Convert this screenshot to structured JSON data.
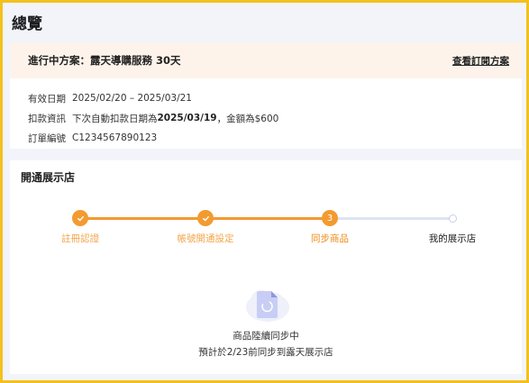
{
  "page": {
    "title": "總覽"
  },
  "plan": {
    "current_plan_label": "進行中方案：露天導購服務 30天",
    "view_link": "查看訂閱方案",
    "rows": [
      {
        "label": "有效日期",
        "value_prefix": "2025/02/20 – 2025/03/21",
        "value_bold": "",
        "value_suffix": ""
      },
      {
        "label": "扣款資訊",
        "value_prefix": "下次自動扣款日期為 ",
        "value_bold": "2025/03/19",
        "value_suffix": "，金額為$600"
      },
      {
        "label": "訂單編號",
        "value_prefix": "C1234567890123",
        "value_bold": "",
        "value_suffix": ""
      }
    ]
  },
  "store": {
    "title": "開通展示店",
    "steps": [
      {
        "label": "註冊認證",
        "status": "done",
        "icon": "check-icon"
      },
      {
        "label": "帳號開通設定",
        "status": "done",
        "icon": "check-icon"
      },
      {
        "label": "同步商品",
        "status": "current",
        "number": "3"
      },
      {
        "label": "我的展示店",
        "status": "pending"
      }
    ],
    "sync_message": "商品陸續同步中",
    "sync_eta": "預計於2/23前同步到露天展示店"
  },
  "colors": {
    "accent": "#f39a30",
    "frame": "#f2c01f",
    "plan_header_bg": "#fdf3ea",
    "pending_line": "#dfe2f2"
  }
}
